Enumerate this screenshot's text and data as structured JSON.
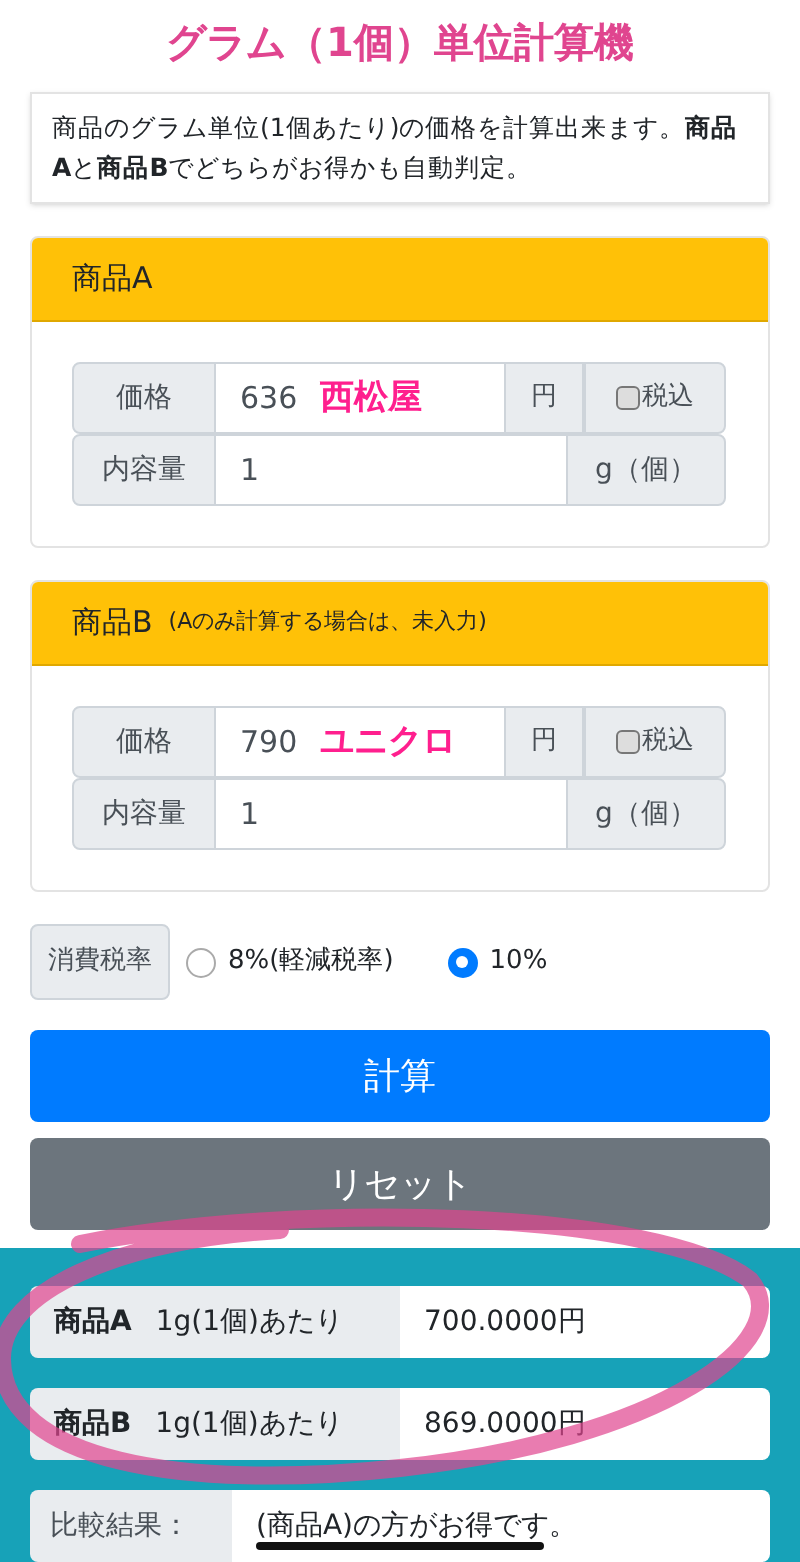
{
  "title": "グラム（1個）単位計算機",
  "description": "商品のグラム単位(1個あたり)の価格を計算出来ます。**商品A**と**商品B**でどちらがお得かも自動判定。",
  "products": [
    {
      "title": "商品A",
      "price_label": "価格",
      "price": "636",
      "price_note": "西松屋",
      "currency": "円",
      "tax_included": {
        "label": "税込",
        "checked": false
      },
      "amount_label": "内容量",
      "amount": "1",
      "unit": "g（個）"
    },
    {
      "title": "商品B",
      "hint": "(Aのみ計算する場合は、未入力)",
      "price_label": "価格",
      "price": "790",
      "price_note": "ユニクロ",
      "currency": "円",
      "tax_included": {
        "label": "税込",
        "checked": false
      },
      "amount_label": "内容量",
      "amount": "1",
      "unit": "g（個）"
    }
  ],
  "tax_rate": {
    "label": "消費税率",
    "options": [
      {
        "label": "8%(軽減税率)",
        "selected": false
      },
      {
        "label": "10%",
        "selected": true
      }
    ]
  },
  "calculate_button": "計算",
  "reset_button": "リセット",
  "results": [
    {
      "product": "商品A",
      "per_unit": "1g(1個)あたり",
      "value": "700.0000円"
    },
    {
      "product": "商品B",
      "per_unit": "1g(1個)あたり",
      "value": "869.0000円"
    }
  ],
  "comparison": {
    "label": "比較結果：",
    "value": "(商品A)の方がお得です。"
  }
}
